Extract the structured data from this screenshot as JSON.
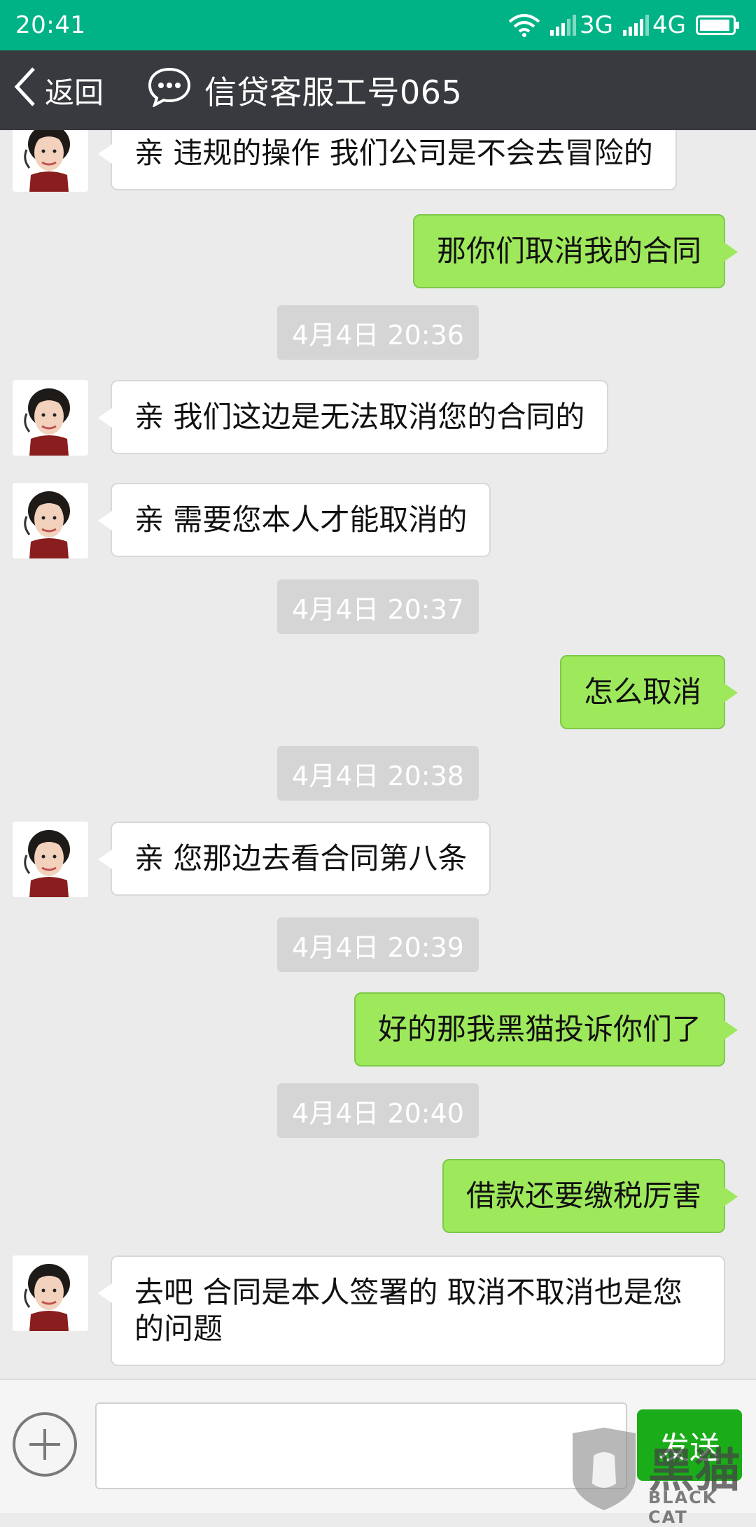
{
  "status_bar": {
    "time": "20:41",
    "network_1": "3G",
    "network_2": "4G",
    "colors": {
      "background": "#00b386"
    }
  },
  "nav": {
    "back_label": "返回",
    "title": "信贷客服工号065",
    "colors": {
      "background": "#393a3f"
    }
  },
  "messages": [
    {
      "type": "left",
      "text": "亲 违规的操作 我们公司是不会去冒险的"
    },
    {
      "type": "right",
      "text": "那你们取消我的合同"
    },
    {
      "type": "time",
      "text": "4月4日 20:36"
    },
    {
      "type": "left",
      "text": "亲 我们这边是无法取消您的合同的"
    },
    {
      "type": "left",
      "text": "亲 需要您本人才能取消的"
    },
    {
      "type": "time",
      "text": "4月4日 20:37"
    },
    {
      "type": "right",
      "text": "怎么取消"
    },
    {
      "type": "time",
      "text": "4月4日 20:38"
    },
    {
      "type": "left",
      "text": "亲 您那边去看合同第八条"
    },
    {
      "type": "time",
      "text": "4月4日 20:39"
    },
    {
      "type": "right",
      "text": "好的那我黑猫投诉你们了"
    },
    {
      "type": "time",
      "text": "4月4日 20:40"
    },
    {
      "type": "right",
      "text": "借款还要缴税厉害"
    },
    {
      "type": "left",
      "text": "去吧 合同是本人签署的  取消不取消也是您的问题"
    }
  ],
  "input_bar": {
    "input_value": "",
    "send_label": "发送"
  },
  "watermark": {
    "text": "黑猫",
    "sub": "BLACK CAT"
  },
  "colors": {
    "chat_bg": "#ebebeb",
    "bubble_right": "#9ee85c",
    "bubble_left": "#ffffff",
    "send_button": "#1aad19"
  }
}
